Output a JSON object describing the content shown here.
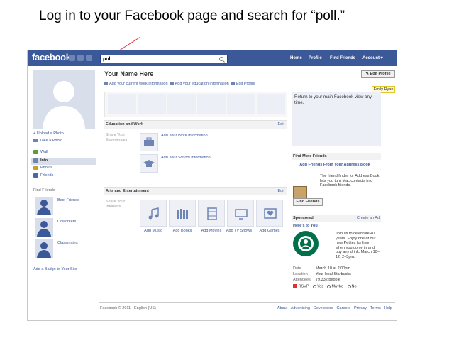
{
  "slide": {
    "caption": "Log in to your Facebook page and search for “poll.”"
  },
  "colors": {
    "brand": "#3b5998",
    "link": "#3b5998",
    "arrow": "#e03030",
    "tooltip_bg": "#fff9d7",
    "starbucks_green": "#00704a"
  },
  "topbar": {
    "logo": "facebook",
    "search": {
      "value": "poll",
      "icon": "magnifier-icon"
    },
    "nav": [
      "Home",
      "Profile",
      "Find Friends",
      "Account ▾"
    ]
  },
  "left": {
    "upload_photo": "+ Upload a Photo",
    "take_photo": "Take a Photo",
    "nav": [
      {
        "label": "Wall",
        "icon": "wall-icon"
      },
      {
        "label": "Info",
        "icon": "info-icon",
        "selected": true
      },
      {
        "label": "Photos",
        "icon": "photos-icon"
      },
      {
        "label": "Friends",
        "icon": "friends-icon"
      }
    ],
    "find_friends_label": "Find Friends",
    "friend_groups": [
      "Best Friends",
      "Coworkers",
      "Classmates"
    ],
    "add_badge": "Add a Badge to Your Site"
  },
  "main": {
    "name": "Your Name Here",
    "edit_links": [
      "Add your current work information",
      "Add your education information",
      "Edit Profile"
    ],
    "education": {
      "title": "Education and Work",
      "edit": "Edit",
      "label": "Share Your Experiences",
      "add_work": "Add Your Work Information",
      "add_school": "Add Your School Information"
    },
    "arts": {
      "title": "Arts and Entertainment",
      "edit": "Edit",
      "label": "Share Your Interests",
      "tiles": [
        {
          "label": "Add Music",
          "icon": "music-note-icon"
        },
        {
          "label": "Add Books",
          "icon": "books-icon"
        },
        {
          "label": "Add Movies",
          "icon": "film-icon"
        },
        {
          "label": "Add TV Shows",
          "icon": "tv-icon"
        },
        {
          "label": "Add Games",
          "icon": "game-icon"
        }
      ]
    }
  },
  "right": {
    "edit_profile": "Edit Profile",
    "tooltip": "Emily Ryan",
    "return_text": "Return to your main Facebook view any time.",
    "find_more": {
      "title": "Find More Friends",
      "link": "Add Friends From Your Address Book",
      "desc": "The friend finder for Address Book lets you turn Mac contacts into Facebook friends.",
      "button": "Find Friends"
    },
    "sponsored": {
      "title": "Sponsored",
      "create_ad": "Create an Ad",
      "ad_title": "Here's to You",
      "ad_text": "Join us to celebrate 40 years. Enjoy one of our new Petites for free when you come in and buy any drink. March 10–12, 2–5pm.",
      "date_label": "Date",
      "date_value": "March 10 at 2:00pm",
      "location_label": "Location",
      "location_value": "Your local Starbucks",
      "attendees_label": "Attendees",
      "attendees_value": "79,332 people",
      "rsvp": "RSVP",
      "yes": "Yes",
      "maybe": "Maybe",
      "no": "No"
    }
  },
  "footer": {
    "left": "Facebook © 2011 · English (US)",
    "right": "About · Advertising · Developers · Careers · Privacy · Terms · Help"
  }
}
